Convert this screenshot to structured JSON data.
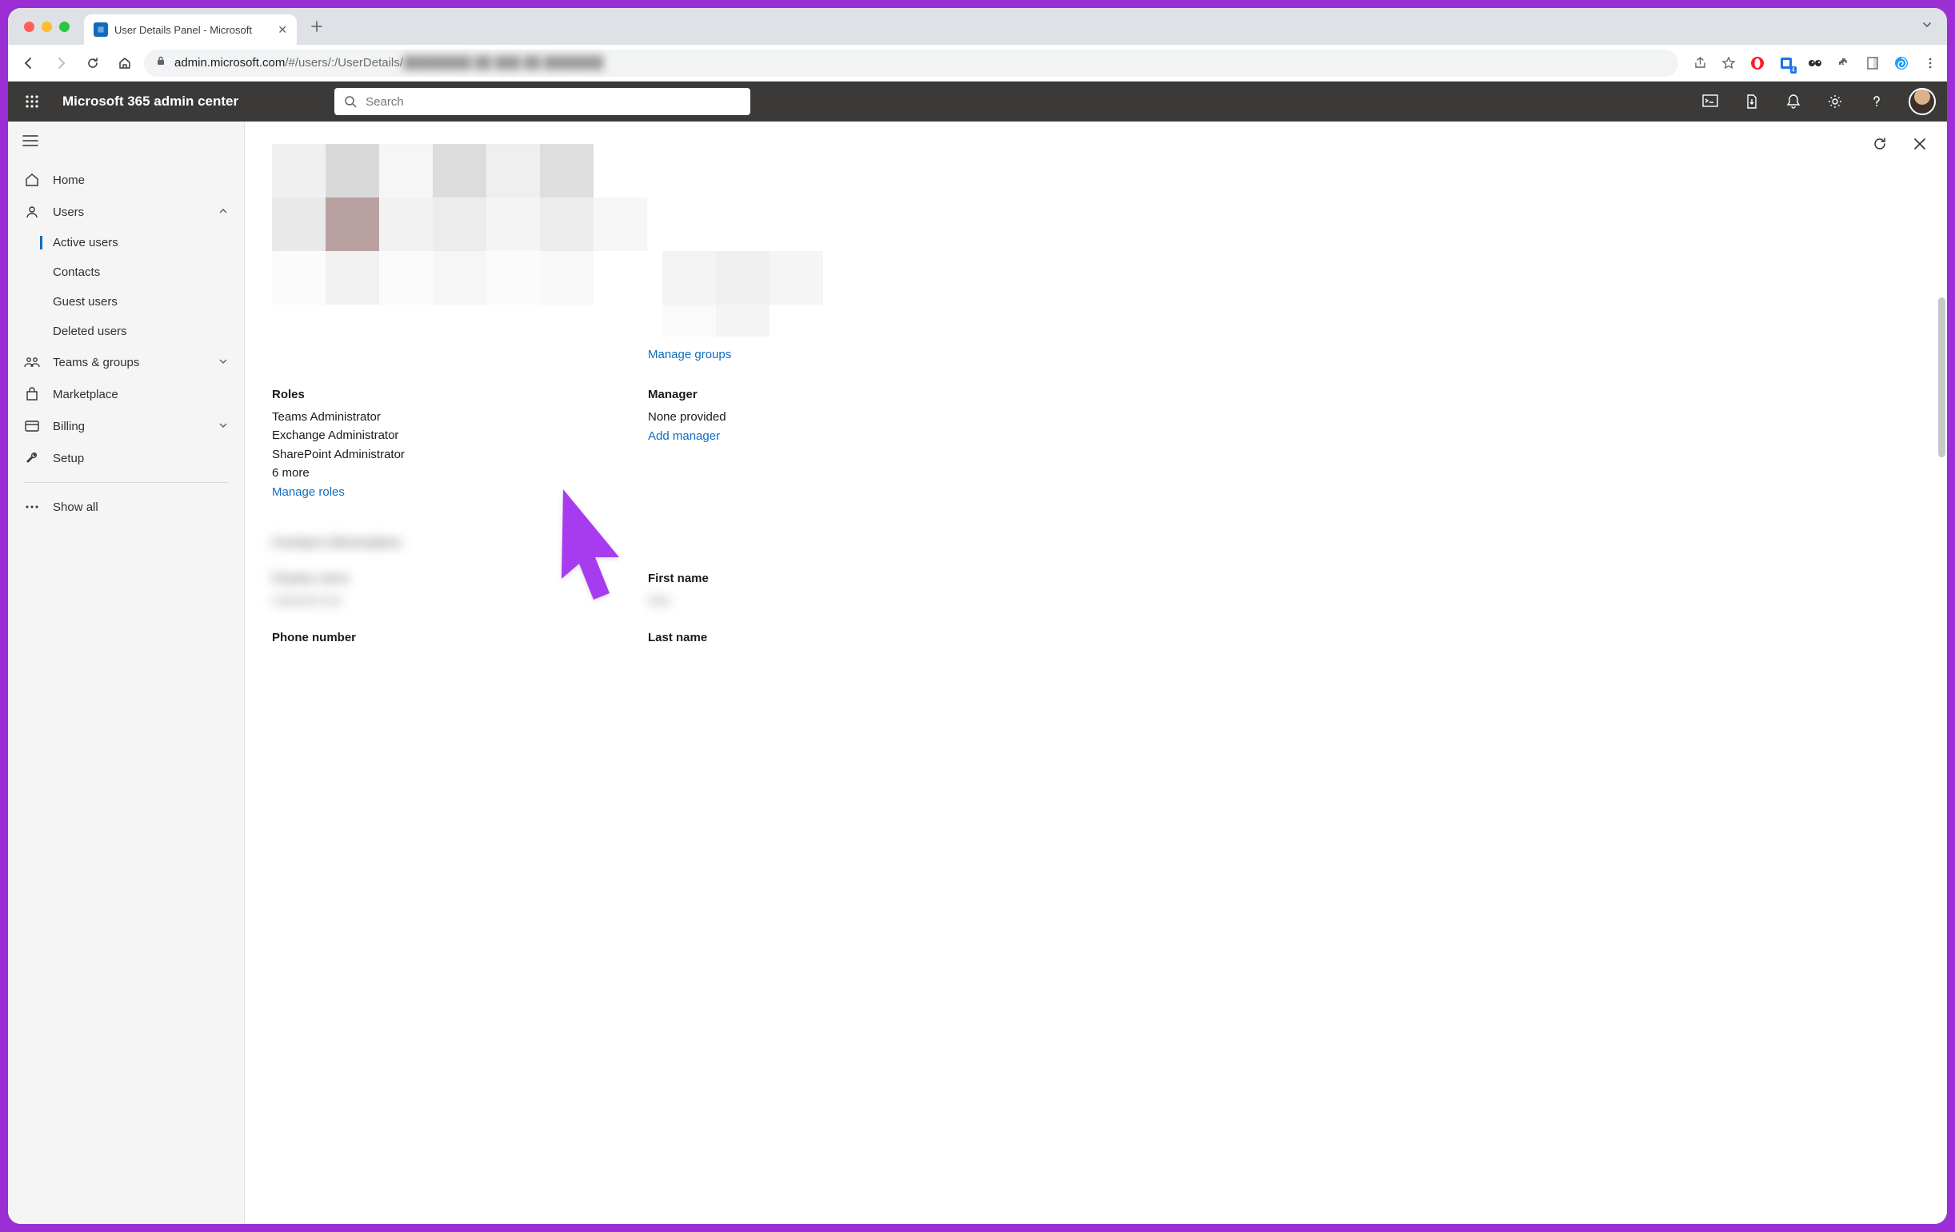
{
  "browser": {
    "tab_title": "User Details Panel - Microsoft",
    "url_domain": "admin.microsoft.com",
    "url_path": "/#/users/:/UserDetails/",
    "url_obscured": "████████ ██ ███ ██ ███████"
  },
  "header": {
    "brand": "Microsoft 365 admin center",
    "search_placeholder": "Search"
  },
  "sidebar": {
    "home": "Home",
    "users": "Users",
    "active_users": "Active users",
    "contacts": "Contacts",
    "guest_users": "Guest users",
    "deleted_users": "Deleted users",
    "teams_groups": "Teams & groups",
    "marketplace": "Marketplace",
    "billing": "Billing",
    "setup": "Setup",
    "show_all": "Show all"
  },
  "panel": {
    "manage_groups": "Manage groups",
    "roles_heading": "Roles",
    "roles_list": [
      "Teams Administrator",
      "Exchange Administrator",
      "SharePoint Administrator"
    ],
    "roles_more": "6 more",
    "manage_roles": "Manage roles",
    "manager_heading": "Manager",
    "manager_value": "None provided",
    "add_manager": "Add manager",
    "contact_heading_blur": "Contact information",
    "display_label_blur": "Display name",
    "display_value_blur": "redacted text",
    "first_name_label": "First name",
    "first_name_blur": "Alex",
    "phone_label": "Phone number",
    "last_name_label": "Last name"
  }
}
